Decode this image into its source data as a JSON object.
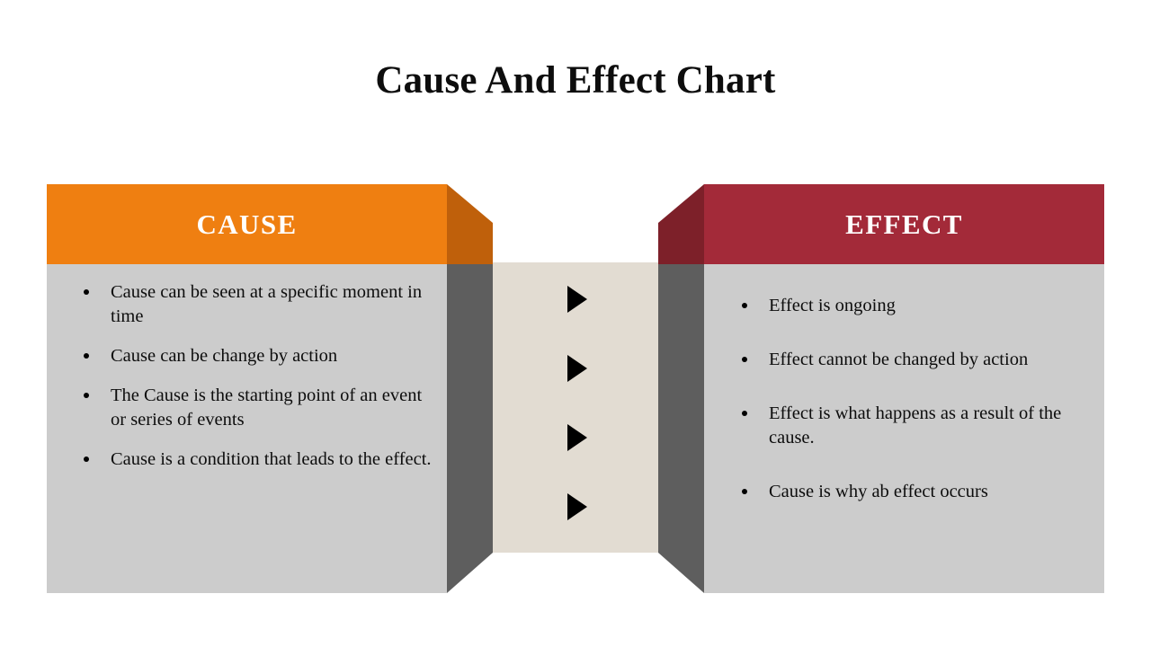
{
  "slide": {
    "title": "Cause And Effect Chart",
    "background_color": "#FFFFFF"
  },
  "colors": {
    "cause_header": "#EF7F11",
    "cause_header_bevel": "#BF600B",
    "effect_header": "#A32A39",
    "effect_header_bevel": "#7D2029",
    "body_gray": "#CCCCCC",
    "body_bevel_gray": "#5E5E5E",
    "center_strip": "#E2DCD2",
    "text": "#0D0D0D",
    "header_text": "#FFFFFF",
    "arrow": "#000000"
  },
  "cause": {
    "header_label": "CAUSE",
    "items": [
      "Cause can be seen at a specific moment in time",
      "Cause can be change by action",
      "The Cause is the starting point of an event or series of events",
      "Cause is a condition that leads to the effect."
    ]
  },
  "effect": {
    "header_label": "EFFECT",
    "items": [
      "Effect is ongoing",
      "Effect cannot be changed by action",
      "Effect is what happens as a result of the cause.",
      "Cause is why ab effect occurs"
    ]
  },
  "center": {
    "arrow_icon": "triangle-right-icon",
    "arrow_count": 4
  }
}
